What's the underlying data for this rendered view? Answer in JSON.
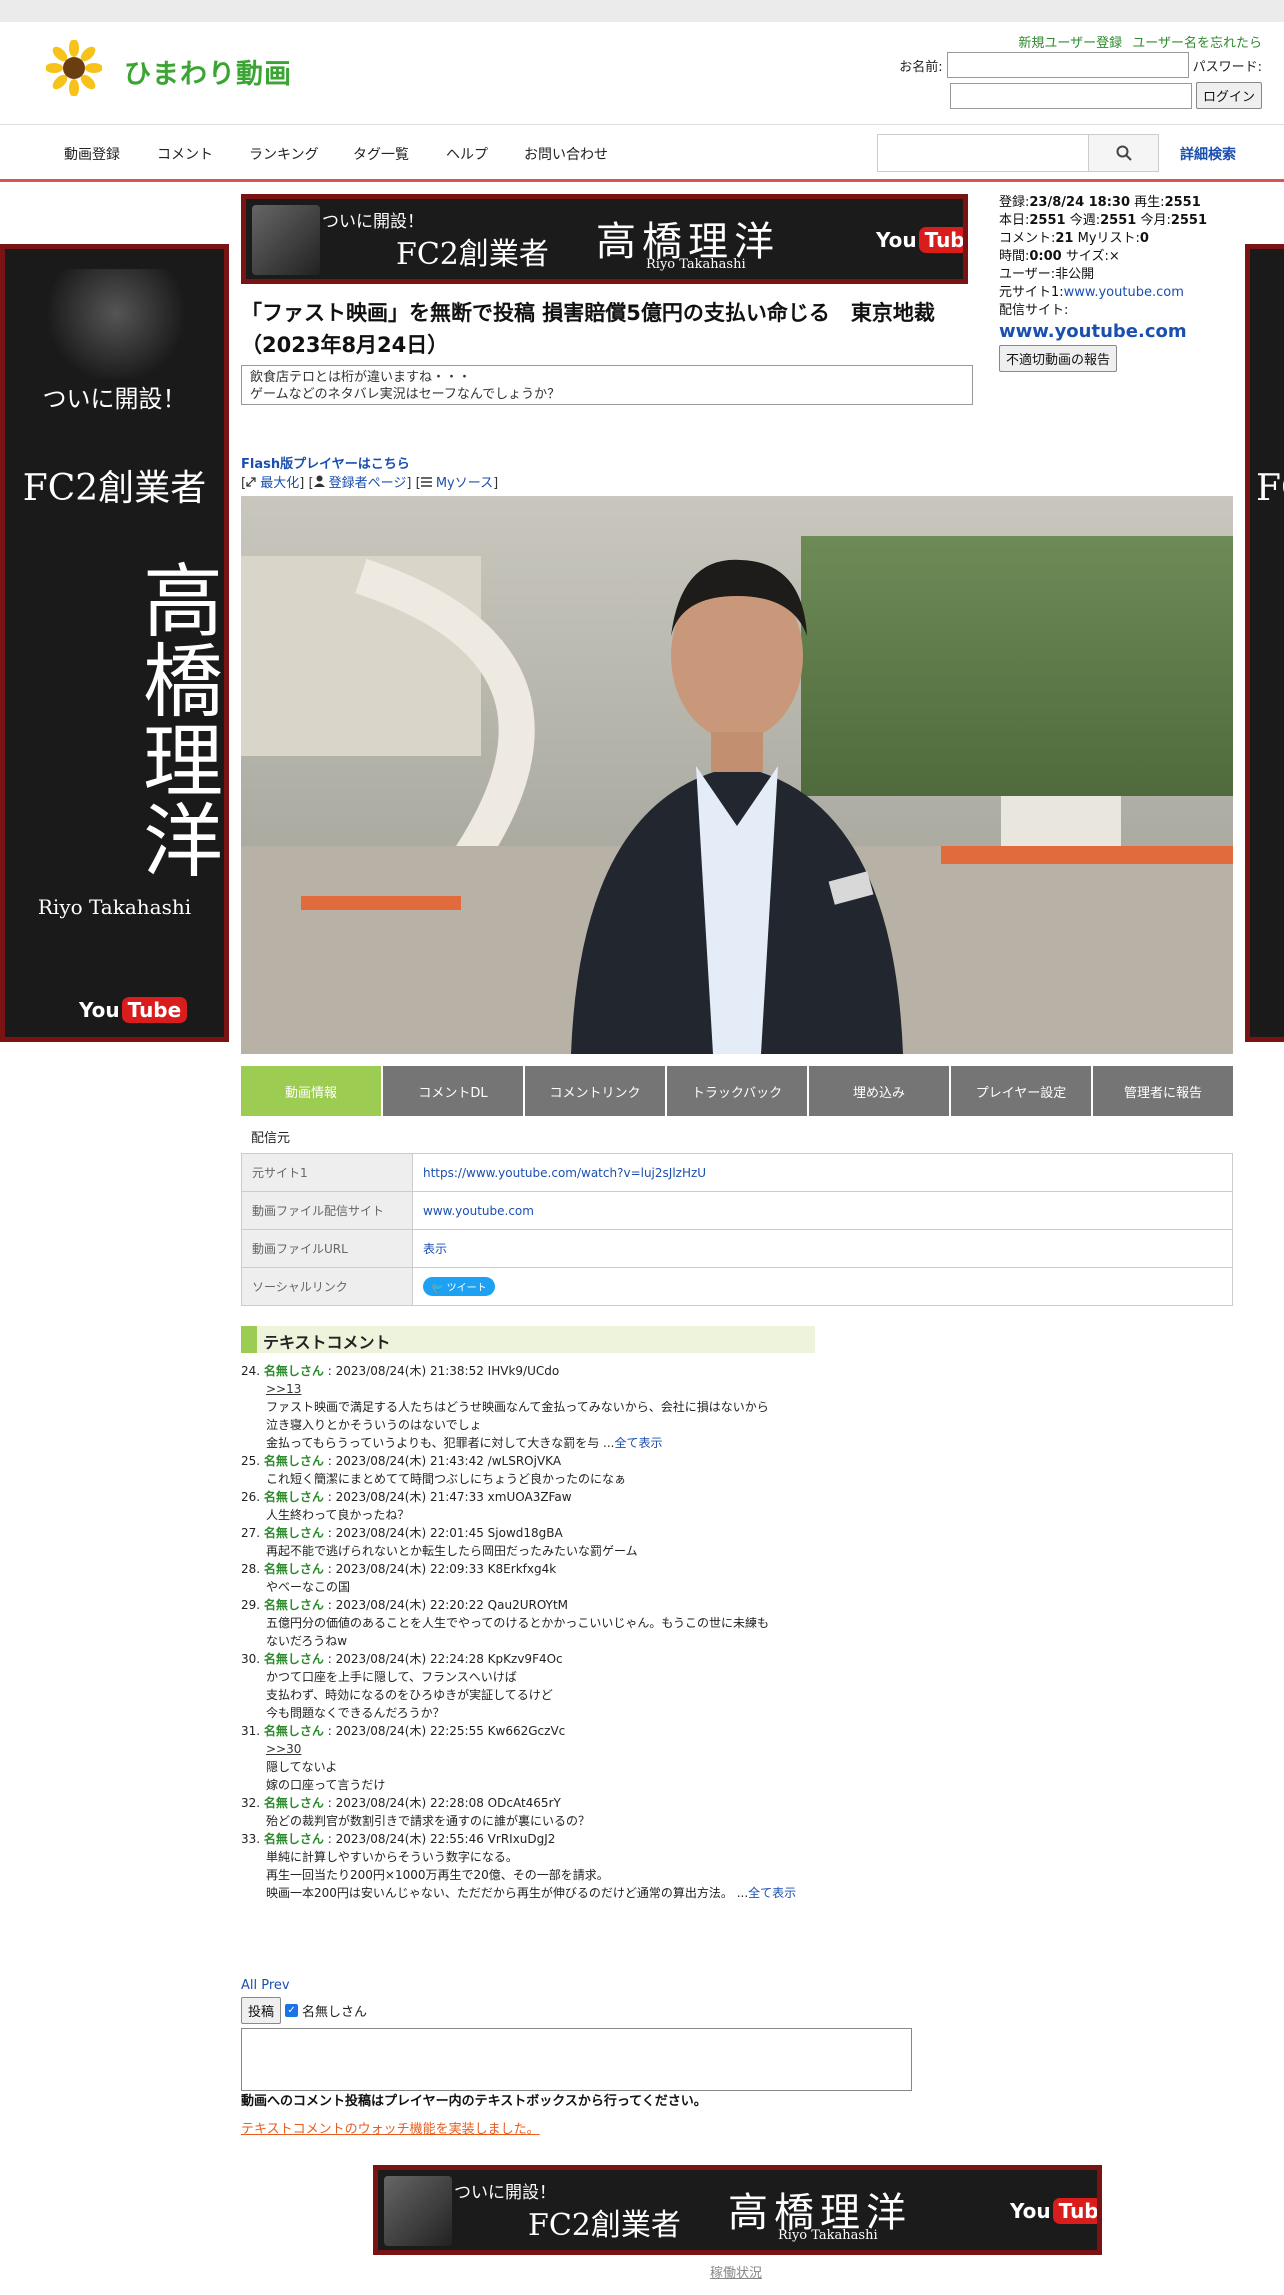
{
  "header": {
    "logo_text": "ひまわり動画",
    "register_link": "新規ユーザー登録",
    "forgot_link": "ユーザー名を忘れたら",
    "name_label": "お名前:",
    "password_label": "パスワード:",
    "login_button": "ログイン"
  },
  "nav": {
    "items": [
      "動画登録",
      "コメント",
      "ランキング",
      "タグ一覧",
      "ヘルプ",
      "お問い合わせ"
    ],
    "advanced_search": "詳細検索"
  },
  "ad": {
    "open_text": "ついに開設！",
    "fc2_text": "FC2創業者",
    "name": "高橋理洋",
    "romaji": "Riyo Takahashi",
    "yt_you": "You",
    "yt_tube": "Tube"
  },
  "video": {
    "title": "「ファスト映画」を無断で投稿 損害賠償5億円の支払い命じる　東京地裁（2023年8月24日）",
    "description_line1": "飲食店テロとは桁が違いますね・・・",
    "description_line2": "ゲームなどのネタバレ実況はセーフなんでしょうか？",
    "flash_link": "Flash版プレイヤーはこちら",
    "maximize_link": "最大化",
    "registrant_link": "登録者ページ",
    "mysource_link": "Myソース"
  },
  "stats": {
    "registered_label": "登録:",
    "registered_value": "23/8/24 18:30",
    "plays_label": "再生:",
    "plays_value": "2551",
    "today_label": "本日:",
    "today_value": "2551",
    "week_label": "今週:",
    "week_value": "2551",
    "month_label": "今月:",
    "month_value": "2551",
    "comments_label": "コメント:",
    "comments_value": "21",
    "mylist_label": "Myリスト:",
    "mylist_value": "0",
    "time_label": "時間:",
    "time_value": "0:00",
    "size_label": "サイズ:",
    "size_value": "×",
    "user_label": "ユーザー:",
    "user_value": "非公開",
    "source1_label": "元サイト1:",
    "source1_value": "www.youtube.com",
    "dist_label": "配信サイト:",
    "dist_value": "www.youtube.com",
    "report_button": "不適切動画の報告"
  },
  "tabs": [
    "動画情報",
    "コメントDL",
    "コメントリンク",
    "トラックバック",
    "埋め込み",
    "プレイヤー設定",
    "管理者に報告"
  ],
  "source_section_label": "配信元",
  "info_table": [
    {
      "key": "元サイト1",
      "value": "https://www.youtube.com/watch?v=luj2sJlzHzU"
    },
    {
      "key": "動画ファイル配信サイト",
      "value": "www.youtube.com"
    },
    {
      "key": "動画ファイルURL",
      "value": "表示"
    },
    {
      "key": "ソーシャルリンク",
      "value": "ツイート"
    }
  ],
  "text_comments_heading": "テキストコメント",
  "comments": [
    {
      "num": "24.",
      "name": "名無しさん",
      "meta": ": 2023/08/24(木) 21:38:52 IHVk9/UCdo",
      "anchor": ">>13",
      "lines": [
        "ファスト映画で満足する人たちはどうせ映画なんて金払ってみないから、会社に損はないから",
        "泣き寝入りとかそういうのはないでしょ",
        "金払ってもらうっていうよりも、犯罪者に対して大きな罰を与 ..."
      ],
      "more": "全て表示"
    },
    {
      "num": "25.",
      "name": "名無しさん",
      "meta": ": 2023/08/24(木) 21:43:42 /wLSROjVKA",
      "lines": [
        "これ短く簡潔にまとめてて時間つぶしにちょうど良かったのになぁ"
      ]
    },
    {
      "num": "26.",
      "name": "名無しさん",
      "meta": ": 2023/08/24(木) 21:47:33 xmUOA3ZFaw",
      "lines": [
        "人生終わって良かったね？"
      ]
    },
    {
      "num": "27.",
      "name": "名無しさん",
      "meta": ": 2023/08/24(木) 22:01:45 Sjowd18gBA",
      "lines": [
        "再起不能で逃げられないとか転生したら岡田だったみたいな罰ゲーム"
      ]
    },
    {
      "num": "28.",
      "name": "名無しさん",
      "meta": ": 2023/08/24(木) 22:09:33 K8Erkfxg4k",
      "lines": [
        "やべーなこの国"
      ]
    },
    {
      "num": "29.",
      "name": "名無しさん",
      "meta": ": 2023/08/24(木) 22:20:22 Qau2UROYtM",
      "lines": [
        "五億円分の価値のあることを人生でやってのけるとかかっこいいじゃん。もうこの世に未練も",
        "ないだろうねw"
      ]
    },
    {
      "num": "30.",
      "name": "名無しさん",
      "meta": ": 2023/08/24(木) 22:24:28 KpKzv9F4Oc",
      "lines": [
        "かつて口座を上手に隠して、フランスへいけば",
        "支払わず、時効になるのをひろゆきが実証してるけど",
        "今も問題なくできるんだろうか？"
      ]
    },
    {
      "num": "31.",
      "name": "名無しさん",
      "meta": ": 2023/08/24(木) 22:25:55 Kw662GczVc",
      "anchor": ">>30",
      "lines": [
        "隠してないよ",
        "嫁の口座って言うだけ"
      ]
    },
    {
      "num": "32.",
      "name": "名無しさん",
      "meta": ": 2023/08/24(木) 22:28:08 ODcAt465rY",
      "lines": [
        "殆どの裁判官が数割引きで請求を通すのに誰が裏にいるの？"
      ]
    },
    {
      "num": "33.",
      "name": "名無しさん",
      "meta": ": 2023/08/24(木) 22:55:46 VrRIxuDgJ2",
      "lines": [
        "単純に計算しやすいからそういう数字になる。",
        "再生一回当たり200円×1000万再生で20億、その一部を請求。",
        "映画一本200円は安いんじゃない、ただだから再生が伸びるのだけど通常の算出方法。 ..."
      ],
      "more": "全て表示"
    }
  ],
  "all_prev": "All Prev",
  "post_button": "投稿",
  "anon_label": "名無しさん",
  "post_notice": "動画へのコメント投稿はプレイヤー内のテキストボックスから行ってください。",
  "watch_link": "テキストコメントのウォッチ機能を実装しました。",
  "footer_link": "稼働状況",
  "colors": {
    "accent_green": "#9ccc52",
    "nav_red": "#d9534f",
    "link_blue": "#1a4fb0",
    "name_green": "#2d8a2d",
    "ad_border": "#7a1414"
  },
  "icons": [
    "sunflower-icon",
    "search-icon",
    "expand-icon",
    "user-icon",
    "list-icon",
    "twitter-icon"
  ]
}
